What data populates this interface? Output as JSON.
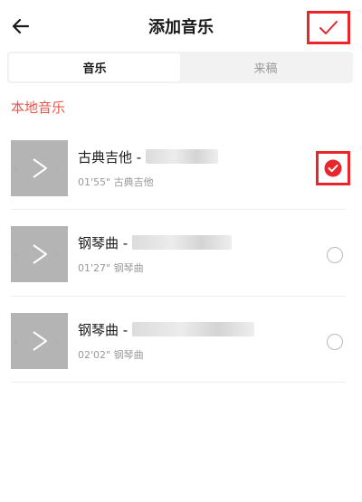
{
  "header": {
    "title": "添加音乐",
    "back_icon": "arrow-left-icon",
    "confirm_icon": "checkmark-icon"
  },
  "tabs": [
    {
      "label": "音乐",
      "active": true
    },
    {
      "label": "来稿",
      "active": false
    }
  ],
  "section": {
    "label": "本地音乐"
  },
  "songs": [
    {
      "title": "古典吉他 - ",
      "duration": "01'55\"",
      "category": "古典吉他",
      "selected": true
    },
    {
      "title": "钢琴曲 - ",
      "duration": "01'27\"",
      "category": "钢琴曲",
      "selected": false
    },
    {
      "title": "钢琴曲 - ",
      "duration": "02'02\"",
      "category": "钢琴曲",
      "selected": false
    }
  ],
  "colors": {
    "accent": "#e8262b",
    "section_label": "#e8564a",
    "thumbnail": "#b4b4b4"
  }
}
